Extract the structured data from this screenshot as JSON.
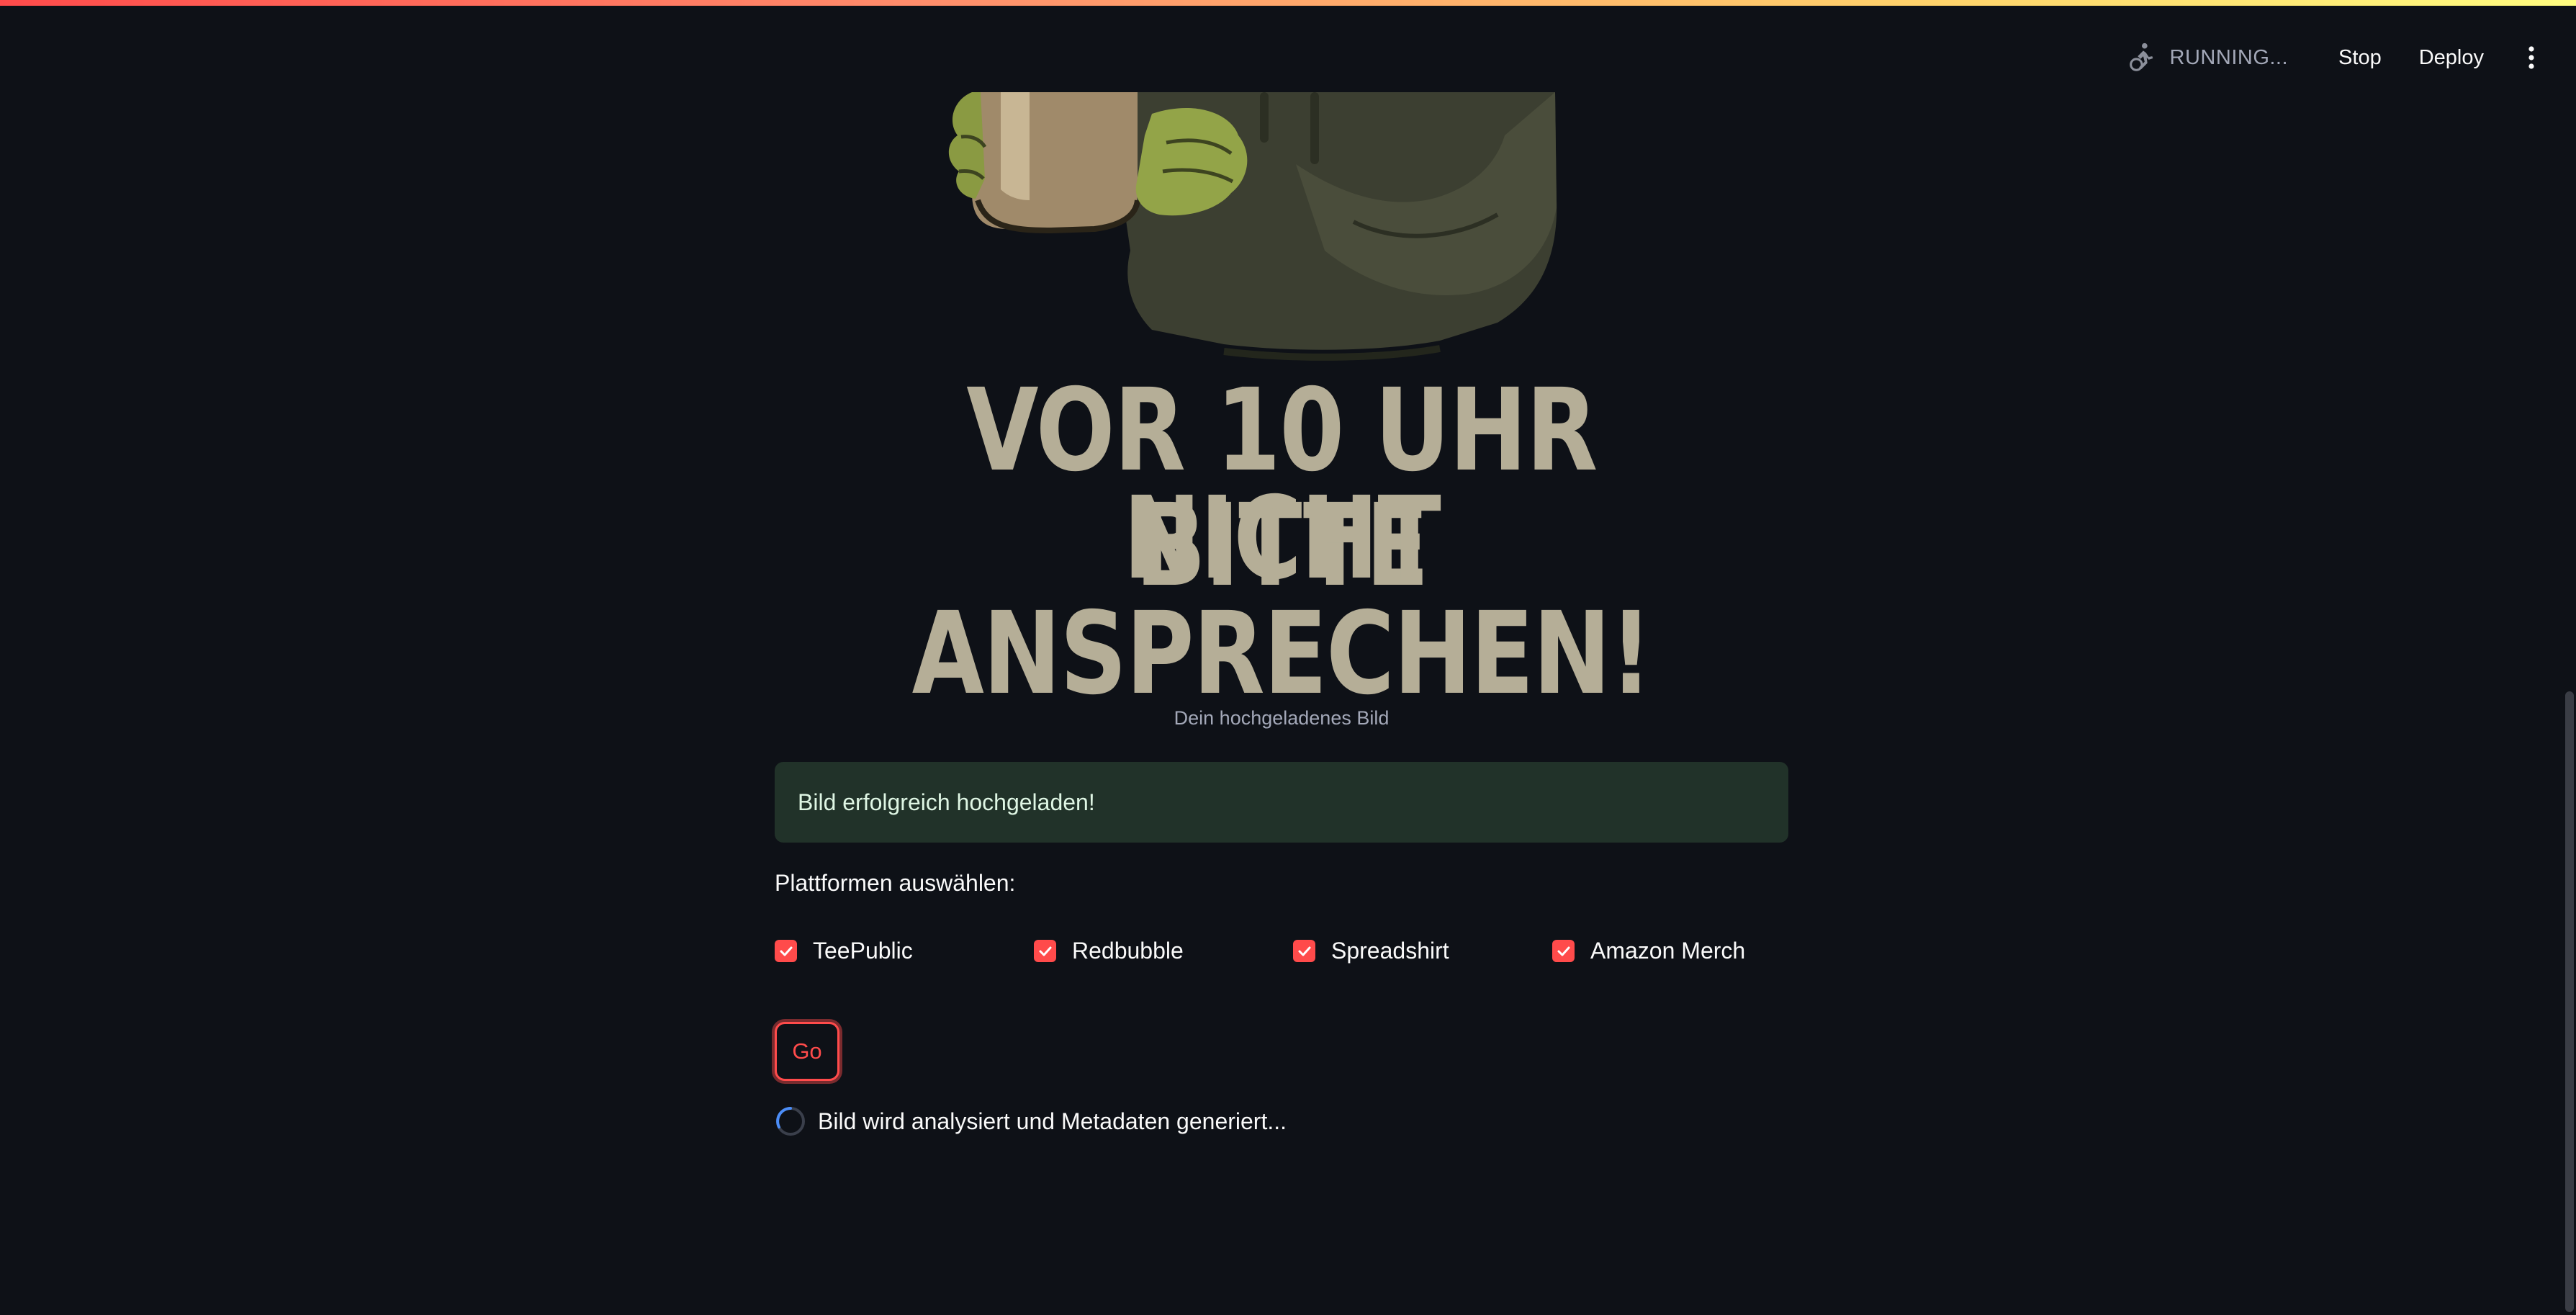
{
  "header": {
    "status_text": "RUNNING...",
    "stop_label": "Stop",
    "deploy_label": "Deploy",
    "running_icon": "running-man-icon",
    "menu_icon": "vertical-dots-icon"
  },
  "uploaded_image": {
    "text_line1": "VOR 10 UHR BITTE",
    "text_line2": "NICHT ANSPRECHEN!",
    "caption": "Dein hochgeladenes Bild"
  },
  "alert": {
    "message": "Bild erfolgreich hochgeladen!"
  },
  "platforms": {
    "label": "Plattformen auswählen:",
    "options": [
      {
        "label": "TeePublic",
        "checked": true
      },
      {
        "label": "Redbubble",
        "checked": true
      },
      {
        "label": "Spreadshirt",
        "checked": true
      },
      {
        "label": "Amazon Merch",
        "checked": true
      }
    ]
  },
  "go_button": {
    "label": "Go"
  },
  "spinner": {
    "text": "Bild wird analysiert und Metadaten generiert..."
  },
  "colors": {
    "background": "#0e1117",
    "accent": "#ff4b4b",
    "success_bg": "#213229",
    "image_text": "#b5ae97"
  }
}
